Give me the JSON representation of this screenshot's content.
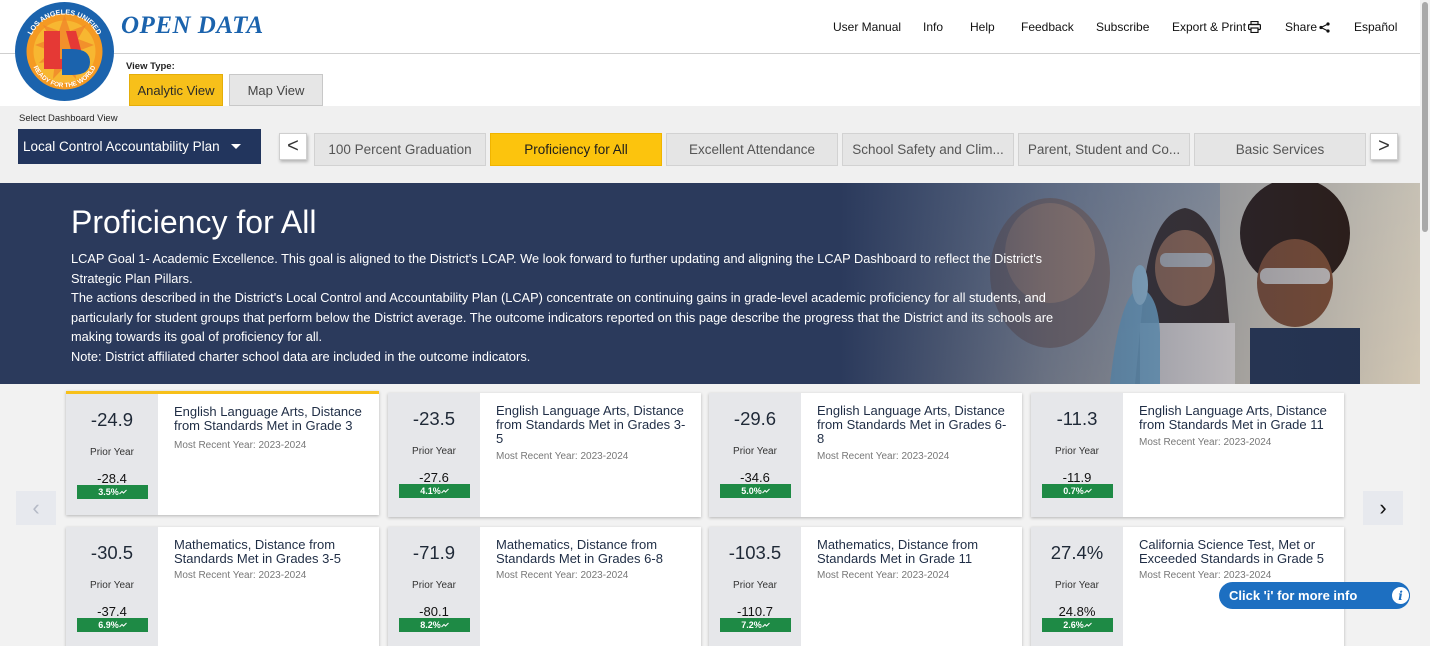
{
  "header": {
    "brand": "OPEN DATA",
    "logo_top_text": "LOS ANGELES UNIFIED",
    "logo_bottom_text": "READY FOR THE WORLD",
    "logo_letters": "LAUSD",
    "nav": [
      {
        "label": "User Manual"
      },
      {
        "label": "Info"
      },
      {
        "label": "Help"
      },
      {
        "label": "Feedback"
      },
      {
        "label": "Subscribe"
      },
      {
        "label": "Export & Print",
        "icon": "printer-icon"
      },
      {
        "label": "Share",
        "icon": "share-icon"
      },
      {
        "label": "Español"
      }
    ]
  },
  "view_type": {
    "label": "View Type:",
    "analytic": "Analytic View",
    "map": "Map View",
    "selected": "Analytic View"
  },
  "dashboard": {
    "label": "Select Dashboard View",
    "selected": "Local Control Accountability Plan",
    "prev": "<",
    "next": ">",
    "tabs": [
      {
        "label": "100 Percent Graduation",
        "active": false
      },
      {
        "label": "Proficiency for All",
        "active": true
      },
      {
        "label": "Excellent Attendance",
        "active": false
      },
      {
        "label": "School Safety and Clim...",
        "active": false
      },
      {
        "label": "Parent, Student and Co...",
        "active": false
      },
      {
        "label": "Basic Services",
        "active": false
      }
    ]
  },
  "hero": {
    "title": "Proficiency for All",
    "lines": [
      "LCAP Goal 1- Academic Excellence. This goal is aligned to the District's LCAP. We look forward to further updating and aligning the LCAP Dashboard to reflect the District's Strategic Plan Pillars.",
      "The actions described in the District's Local Control and Accountability Plan (LCAP) concentrate on continuing gains in grade-level academic proficiency for all students, and particularly for student groups that perform below the District average. The outcome indicators reported on this page describe the progress that the District and its schools are making towards its goal of proficiency for all.",
      "Note: District affiliated charter school data are included in the outcome indicators."
    ]
  },
  "cards": [
    {
      "value": "-24.9",
      "prior_label": "Prior Year",
      "prior_value": "-28.4",
      "change": "3.5%",
      "title": "English Language Arts, Distance from Standards Met in Grade 3",
      "recent": "Most Recent Year: 2023-2024"
    },
    {
      "value": "-23.5",
      "prior_label": "Prior Year",
      "prior_value": "-27.6",
      "change": "4.1%",
      "title": "English Language Arts, Distance from Standards Met in Grades 3-5",
      "recent": "Most Recent Year: 2023-2024"
    },
    {
      "value": "-29.6",
      "prior_label": "Prior Year",
      "prior_value": "-34.6",
      "change": "5.0%",
      "title": "English Language Arts, Distance from Standards Met in Grades 6-8",
      "recent": "Most Recent Year: 2023-2024"
    },
    {
      "value": "-11.3",
      "prior_label": "Prior Year",
      "prior_value": "-11.9",
      "change": "0.7%",
      "title": "English Language Arts, Distance from Standards Met in Grade 11",
      "recent": "Most Recent Year: 2023-2024"
    },
    {
      "value": "-30.5",
      "prior_label": "Prior Year",
      "prior_value": "-37.4",
      "change": "6.9%",
      "title": "Mathematics, Distance from Standards Met in Grades 3-5",
      "recent": "Most Recent Year: 2023-2024"
    },
    {
      "value": "-71.9",
      "prior_label": "Prior Year",
      "prior_value": "-80.1",
      "change": "8.2%",
      "title": "Mathematics, Distance from Standards Met in Grades 6-8",
      "recent": "Most Recent Year: 2023-2024"
    },
    {
      "value": "-103.5",
      "prior_label": "Prior Year",
      "prior_value": "-110.7",
      "change": "7.2%",
      "title": "Mathematics, Distance from Standards Met in Grade 11",
      "recent": "Most Recent Year: 2023-2024"
    },
    {
      "value": "27.4%",
      "prior_label": "Prior Year",
      "prior_value": "24.8%",
      "change": "2.6%",
      "title": "California Science Test, Met or Exceeded Standards in Grade 5",
      "recent": "Most Recent Year: 2023-2024"
    }
  ],
  "pager": {
    "prev": "‹",
    "next": "›"
  },
  "info_pill": {
    "label": "Click 'i' for more info",
    "icon_text": "i"
  },
  "colors": {
    "navy": "#22355d",
    "accent_yellow": "#fcc40d",
    "badge_green": "#1e8a45",
    "brand_blue": "#1b63ad",
    "info_blue": "#1d6fc1"
  }
}
